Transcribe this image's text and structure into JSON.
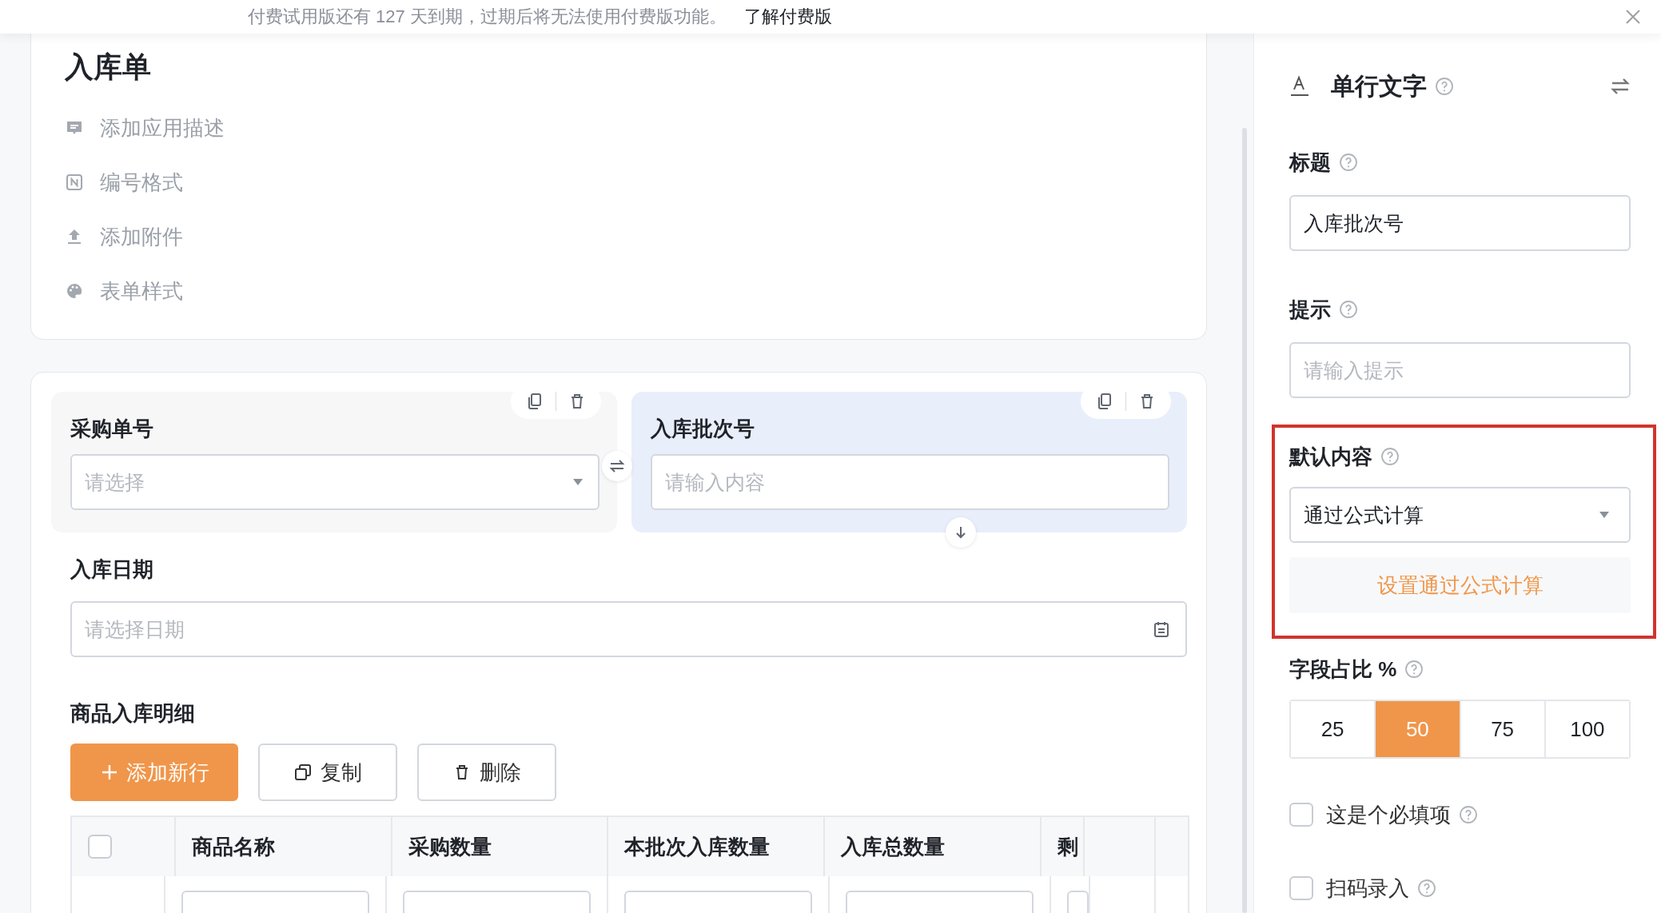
{
  "banner": {
    "text": "付费试用版还有 127 天到期，过期后将无法使用付费版功能。",
    "link": "了解付费版"
  },
  "form": {
    "title": "入库单",
    "actions": [
      {
        "kind": "description",
        "label": "添加应用描述"
      },
      {
        "kind": "numbering",
        "label": "编号格式"
      },
      {
        "kind": "attachment",
        "label": "添加附件"
      },
      {
        "kind": "style",
        "label": "表单样式"
      }
    ]
  },
  "fields": [
    {
      "label": "采购单号",
      "kind": "select",
      "placeholder": "请选择",
      "selected": false
    },
    {
      "label": "入库批次号",
      "kind": "text",
      "placeholder": "请输入内容",
      "selected": true
    }
  ],
  "date_field": {
    "label": "入库日期",
    "placeholder": "请选择日期"
  },
  "detail": {
    "title": "商品入库明细",
    "buttons": [
      {
        "kind": "add",
        "label": "添加新行"
      },
      {
        "kind": "copy",
        "label": "复制"
      },
      {
        "kind": "delete",
        "label": "删除"
      }
    ],
    "select_all": {
      "checked": false
    },
    "columns": [
      "商品名称",
      "采购数量",
      "本批次入库数量",
      "入库总数量",
      "剩"
    ]
  },
  "panel": {
    "title": "单行文字",
    "title_field": {
      "label": "标题",
      "value": "入库批次号"
    },
    "hint_field": {
      "label": "提示",
      "placeholder": "请输入提示"
    },
    "default": {
      "label": "默认内容",
      "value": "通过公式计算",
      "action": "设置通过公式计算"
    },
    "width": {
      "label": "字段占比 %",
      "options": [
        {
          "label": "25",
          "selected": false
        },
        {
          "label": "50",
          "selected": true
        },
        {
          "label": "75",
          "selected": false
        },
        {
          "label": "100",
          "selected": false
        }
      ]
    },
    "checks": [
      {
        "label": "这是个必填项",
        "checked": false
      },
      {
        "label": "扫码录入",
        "checked": false
      }
    ]
  }
}
